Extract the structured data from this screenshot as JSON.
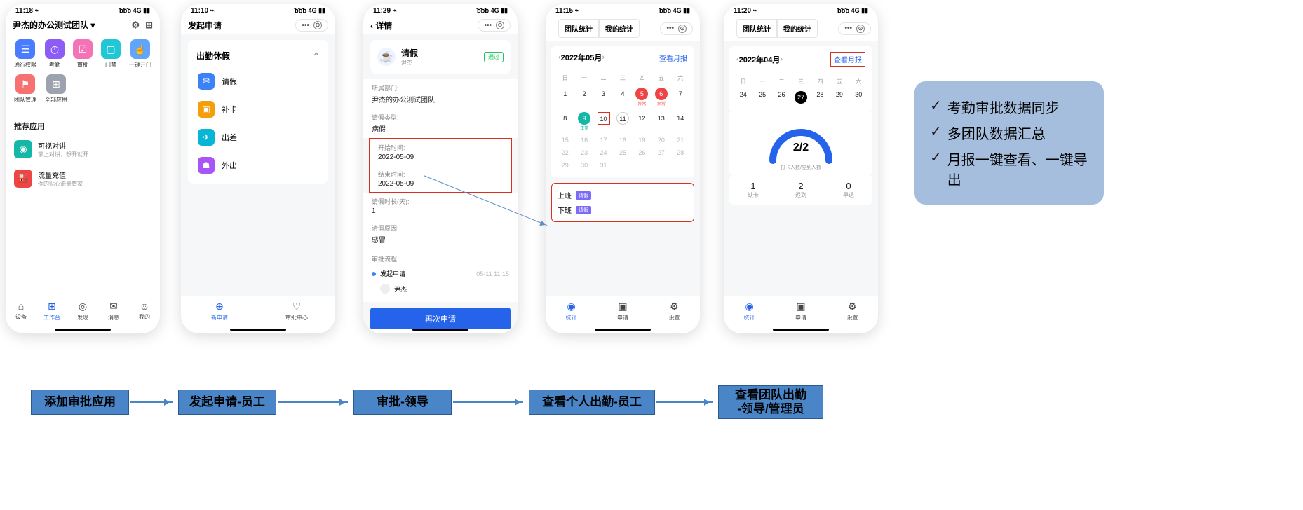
{
  "status": {
    "t1": "11:18 ⌁",
    "t2": "11:10 ⌁",
    "t3": "11:29 ⌁",
    "t4": "11:15 ⌁",
    "t5": "11:20 ⌁",
    "net": "␢␢␢ 4G ▮▮"
  },
  "p1": {
    "title": "尹杰的办公测试团队 ▾",
    "apps": [
      {
        "label": "通行权限",
        "color": "#4a7cff",
        "ic": "☰"
      },
      {
        "label": "考勤",
        "color": "#8b5cf6",
        "ic": "◷"
      },
      {
        "label": "审批",
        "color": "#f472b6",
        "ic": "☑"
      },
      {
        "label": "门禁",
        "color": "#22c7d6",
        "ic": "▢"
      },
      {
        "label": "一键开门",
        "color": "#60a5fa",
        "ic": "☝"
      }
    ],
    "apps2": [
      {
        "label": "团队管理",
        "color": "#f87171",
        "ic": "⚑"
      },
      {
        "label": "全部应用",
        "color": "#9ca3af",
        "ic": "⊞"
      }
    ],
    "section": "推荐应用",
    "reco": [
      {
        "title": "可视对讲",
        "sub": "掌上对讲，想开就开",
        "color": "#14b8a6",
        "ic": "◉"
      },
      {
        "title": "流量充值",
        "sub": "你的贴心流量管家",
        "color": "#ef4444",
        "ic": "⛽"
      }
    ],
    "tabs": [
      "设备",
      "工作台",
      "发现",
      "消息",
      "我的"
    ]
  },
  "p2": {
    "title": "发起申请",
    "acc_title": "出勤休假",
    "items": [
      {
        "label": "请假",
        "color": "#3b82f6",
        "ic": "✉"
      },
      {
        "label": "补卡",
        "color": "#f59e0b",
        "ic": "▣"
      },
      {
        "label": "出差",
        "color": "#06b6d4",
        "ic": "✈"
      },
      {
        "label": "外出",
        "color": "#a855f7",
        "ic": "☗"
      }
    ],
    "tabs": [
      "新申请",
      "审批中心"
    ]
  },
  "p3": {
    "back": "‹ 详情",
    "card_title": "请假",
    "card_user": "尹杰",
    "badge": "通过",
    "fields": [
      {
        "k": "所属部门:",
        "v": "尹杰的办公测试团队"
      },
      {
        "k": "请假类型:",
        "v": "病假"
      }
    ],
    "time_fields": [
      {
        "k": "开始时间:",
        "v": "2022-05-09"
      },
      {
        "k": "结束时间:",
        "v": "2022-05-09"
      }
    ],
    "fields2": [
      {
        "k": "请假时长(天):",
        "v": "1"
      },
      {
        "k": "请假原因:",
        "v": "感冒"
      }
    ],
    "flow_title": "审批流程",
    "flow1": "发起申请",
    "flow1_time": "05-11 11:15",
    "flow2": "尹杰",
    "btn": "再次申请"
  },
  "p4": {
    "tab1": "团队统计",
    "tab2": "我的统计",
    "month": "2022年05月",
    "link": "查看月报",
    "wdays": [
      "日",
      "一",
      "二",
      "三",
      "四",
      "五",
      "六"
    ],
    "r1": [
      "1",
      "2",
      "3",
      "4",
      "5",
      "6",
      "7"
    ],
    "r1_sub5": "异常",
    "r1_sub6": "异常",
    "r2": [
      "8",
      "9",
      "10",
      "11",
      "12",
      "13",
      "14"
    ],
    "r2_sub9": "正常",
    "r3": [
      "15",
      "16",
      "17",
      "18",
      "19",
      "20",
      "21"
    ],
    "r4": [
      "22",
      "23",
      "24",
      "25",
      "26",
      "27",
      "28"
    ],
    "r5": [
      "29",
      "30",
      "31",
      "",
      "",
      "",
      ""
    ],
    "shift1": "上班",
    "shift2": "下班",
    "tag": "请假",
    "tabs": [
      "统计",
      "申请",
      "设置"
    ]
  },
  "p5": {
    "tab1": "团队统计",
    "tab2": "我的统计",
    "month": "2022年04月",
    "link": "查看月报",
    "wdays": [
      "日",
      "一",
      "二",
      "三",
      "四",
      "五",
      "六"
    ],
    "r1": [
      "24",
      "25",
      "26",
      "27",
      "28",
      "29",
      "30"
    ],
    "gauge": "2/2",
    "gauge_sub": "打卡人数/应到人数",
    "stats": [
      {
        "n": "1",
        "l": "缺卡"
      },
      {
        "n": "2",
        "l": "迟到"
      },
      {
        "n": "0",
        "l": "早退"
      }
    ],
    "tabs": [
      "统计",
      "申请",
      "设置"
    ]
  },
  "bubble": [
    "考勤审批数据同步",
    "多团队数据汇总",
    "月报一键查看、一键导出"
  ],
  "flow": [
    "添加审批应用",
    "发起申请-员工",
    "审批-领导",
    "查看个人出勤-员工",
    "查看团队出勤\n-领导/管理员"
  ]
}
